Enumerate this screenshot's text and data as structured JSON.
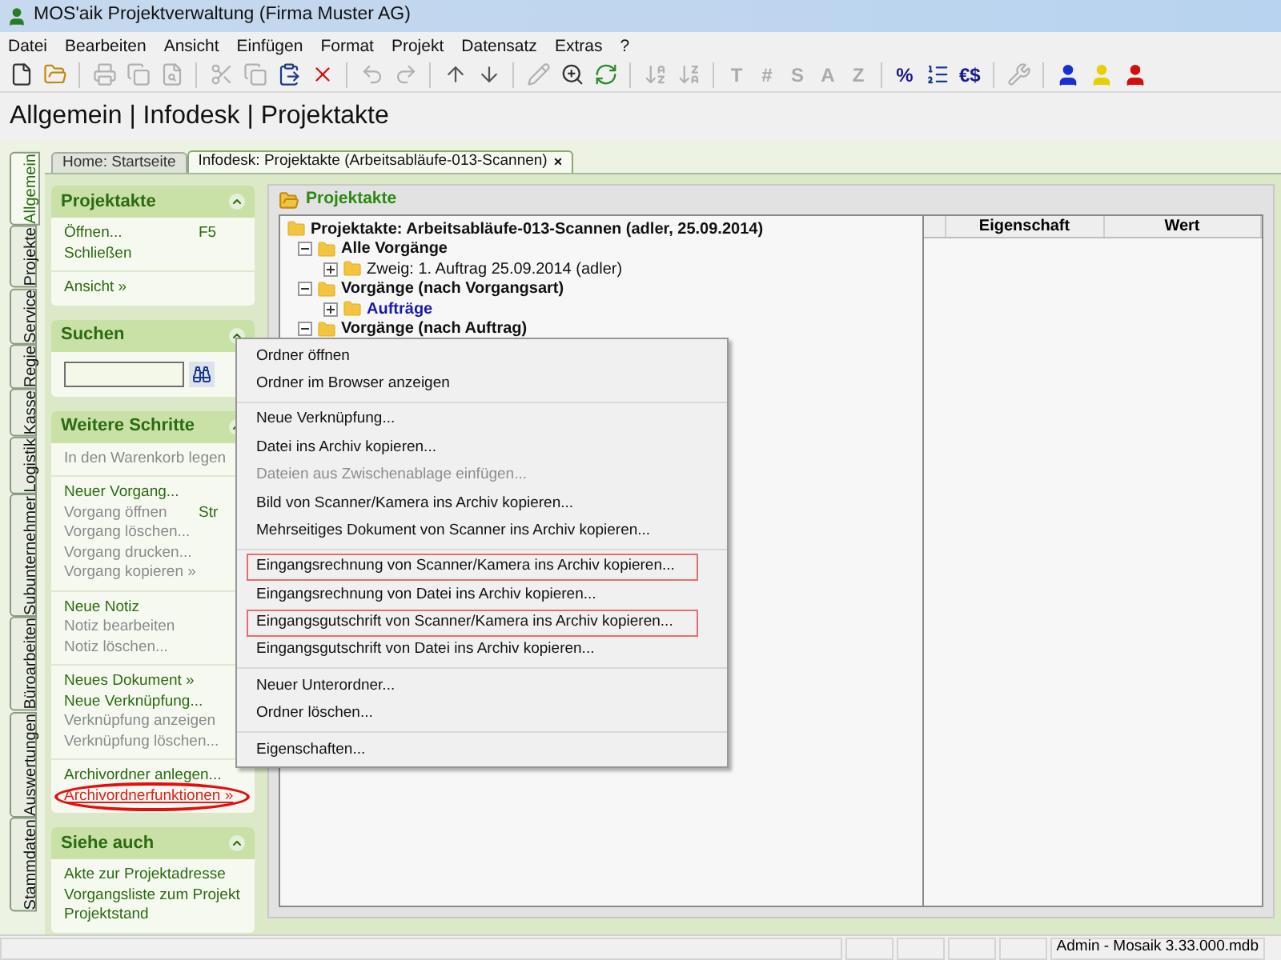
{
  "window": {
    "title": "MOS'aik Projektverwaltung (Firma Muster AG)"
  },
  "menu": [
    "Datei",
    "Bearbeiten",
    "Ansicht",
    "Einfügen",
    "Format",
    "Projekt",
    "Datensatz",
    "Extras",
    "?"
  ],
  "toolbar": [
    {
      "kind": "icon",
      "disabled": false
    },
    {
      "kind": "icon",
      "disabled": false
    },
    {
      "kind": "separator"
    },
    {
      "kind": "icon",
      "disabled": true
    },
    {
      "kind": "icon",
      "disabled": true
    },
    {
      "kind": "icon",
      "disabled": true
    },
    {
      "kind": "separator"
    },
    {
      "kind": "icon",
      "disabled": true
    },
    {
      "kind": "icon",
      "disabled": true
    },
    {
      "kind": "icon",
      "disabled": false
    },
    {
      "kind": "icon",
      "disabled": false
    },
    {
      "kind": "separator"
    },
    {
      "kind": "icon",
      "disabled": true
    },
    {
      "kind": "icon",
      "disabled": true
    },
    {
      "kind": "separator"
    },
    {
      "kind": "icon",
      "disabled": false
    },
    {
      "kind": "icon",
      "disabled": false
    },
    {
      "kind": "separator"
    },
    {
      "kind": "icon",
      "disabled": true
    },
    {
      "kind": "icon",
      "disabled": false
    },
    {
      "kind": "icon",
      "disabled": false
    },
    {
      "kind": "separator"
    },
    {
      "kind": "icon",
      "disabled": true
    },
    {
      "kind": "icon",
      "disabled": true
    },
    {
      "kind": "separator"
    },
    {
      "kind": "text",
      "label": "T",
      "disabled": true
    },
    {
      "kind": "text",
      "label": "#",
      "disabled": true
    },
    {
      "kind": "text",
      "label": "S",
      "disabled": true
    },
    {
      "kind": "text",
      "label": "A",
      "disabled": true
    },
    {
      "kind": "text",
      "label": "Z",
      "disabled": true
    },
    {
      "kind": "separator"
    },
    {
      "kind": "text",
      "label": "%",
      "disabled": false
    },
    {
      "kind": "icon",
      "disabled": false
    },
    {
      "kind": "text",
      "label": "€$",
      "disabled": false
    },
    {
      "kind": "separator"
    },
    {
      "kind": "icon",
      "disabled": true
    },
    {
      "kind": "separator"
    },
    {
      "kind": "user",
      "color": "#1a2fd0",
      "disabled": false
    },
    {
      "kind": "user",
      "color": "#e8d000",
      "disabled": false
    },
    {
      "kind": "user",
      "color": "#d01010",
      "disabled": false
    }
  ],
  "breadcrumb": "Allgemein | Infodesk | Projektakte",
  "side_tabs": [
    {
      "label": "Allgemein",
      "selected": true
    },
    {
      "label": "Projekte",
      "selected": false
    },
    {
      "label": "Service",
      "selected": false
    },
    {
      "label": "Regie",
      "selected": false
    },
    {
      "label": "Kasse",
      "selected": false
    },
    {
      "label": "Logistik",
      "selected": false
    },
    {
      "label": "Subunternehmer",
      "selected": false
    },
    {
      "label": "Büroarbeiten",
      "selected": false
    },
    {
      "label": "Auswertungen",
      "selected": false
    },
    {
      "label": "Stammdaten",
      "selected": false
    }
  ],
  "doc_tabs": [
    {
      "label": "Home: Startseite",
      "selected": false,
      "closable": false
    },
    {
      "label": "Infodesk: Projektakte (Arbeitsabläufe-013-Scannen)",
      "selected": true,
      "closable": true,
      "close": "×"
    }
  ],
  "task_pane": [
    {
      "kind": "links",
      "title": "Projektakte",
      "groups": [
        [
          {
            "label": "Öffnen...",
            "shortcut": "F5",
            "disabled": false
          },
          {
            "label": "Schließen",
            "disabled": false
          }
        ],
        [
          {
            "label": "Ansicht »",
            "disabled": false
          }
        ]
      ]
    },
    {
      "kind": "search",
      "title": "Suchen"
    },
    {
      "kind": "links",
      "title": "Weitere Schritte",
      "groups": [
        [
          {
            "label": "In den Warenkorb legen",
            "disabled": true
          }
        ],
        [
          {
            "label": "Neuer Vorgang...",
            "disabled": false
          },
          {
            "label": "Vorgang öffnen",
            "shortcut": "Str",
            "disabled": true
          },
          {
            "label": "Vorgang löschen...",
            "disabled": true
          },
          {
            "label": "Vorgang drucken...",
            "disabled": true
          },
          {
            "label": "Vorgang kopieren »",
            "disabled": true
          }
        ],
        [
          {
            "label": "Neue Notiz",
            "disabled": false
          },
          {
            "label": "Notiz bearbeiten",
            "disabled": true
          },
          {
            "label": "Notiz löschen...",
            "disabled": true
          }
        ],
        [
          {
            "label": "Neues Dokument »",
            "disabled": false
          },
          {
            "label": "Neue Verknüpfung...",
            "disabled": false
          },
          {
            "label": "Verknüpfung anzeigen",
            "disabled": true
          },
          {
            "label": "Verknüpfung löschen...",
            "disabled": true
          }
        ],
        [
          {
            "label": "Archivordner anlegen...",
            "disabled": false
          },
          {
            "label": "Archivordnerfunktionen »",
            "disabled": false,
            "circled": true
          }
        ]
      ]
    },
    {
      "kind": "links",
      "title": "Siehe auch",
      "groups": [
        [
          {
            "label": "Akte zur Projektadresse",
            "disabled": false
          },
          {
            "label": "Vorgangsliste zum Projekt",
            "disabled": false
          },
          {
            "label": "Projektstand",
            "disabled": false
          }
        ]
      ]
    }
  ],
  "main": {
    "title": "Projektakte",
    "tree": {
      "label": "Projektakte: Arbeitsabläufe-013-Scannen (adler, 25.09.2014)",
      "children": [
        {
          "label": "Alle Vorgänge",
          "expanded": true,
          "bold": true,
          "children": [
            {
              "label": "Zweig: 1. Auftrag 25.09.2014 (adler)",
              "expanded": false,
              "bold": false,
              "link": false
            }
          ]
        },
        {
          "label": "Vorgänge (nach Vorgangsart)",
          "expanded": true,
          "bold": true,
          "children": [
            {
              "label": "Aufträge",
              "expanded": false,
              "bold": true,
              "link": true
            }
          ]
        },
        {
          "label": "Vorgänge (nach Auftrag)",
          "expanded": true,
          "bold": true
        }
      ]
    },
    "properties": {
      "columns": [
        "",
        "Eigenschaft",
        "Wert"
      ]
    }
  },
  "context_menu": [
    [
      {
        "label": "Ordner öffnen",
        "disabled": false,
        "highlighted": false
      },
      {
        "label": "Ordner im Browser anzeigen",
        "disabled": false,
        "highlighted": false
      }
    ],
    [
      {
        "label": "Neue Verknüpfung...",
        "disabled": false,
        "highlighted": false
      },
      {
        "label": "Datei ins Archiv kopieren...",
        "disabled": false,
        "highlighted": false
      },
      {
        "label": "Dateien aus Zwischenablage einfügen...",
        "disabled": true,
        "highlighted": false
      },
      {
        "label": "Bild von Scanner/Kamera ins Archiv kopieren...",
        "disabled": false,
        "highlighted": false
      },
      {
        "label": "Mehrseitiges Dokument von Scanner ins Archiv kopieren...",
        "disabled": false,
        "highlighted": false
      }
    ],
    [
      {
        "label": "Eingangsrechnung von Scanner/Kamera ins Archiv kopieren...",
        "disabled": false,
        "highlighted": true
      },
      {
        "label": "Eingangsrechnung von Datei ins Archiv kopieren...",
        "disabled": false,
        "highlighted": false
      },
      {
        "label": "Eingangsgutschrift von Scanner/Kamera ins Archiv kopieren...",
        "disabled": false,
        "highlighted": true
      },
      {
        "label": "Eingangsgutschrift von Datei ins Archiv kopieren...",
        "disabled": false,
        "highlighted": false
      }
    ],
    [
      {
        "label": "Neuer Unterordner...",
        "disabled": false,
        "highlighted": false
      },
      {
        "label": "Ordner löschen...",
        "disabled": false,
        "highlighted": false
      }
    ],
    [
      {
        "label": "Eigenschaften...",
        "disabled": false,
        "highlighted": false
      }
    ]
  ],
  "status_bar": {
    "text": "Admin - Mosaik 3.33.000.mdb"
  }
}
